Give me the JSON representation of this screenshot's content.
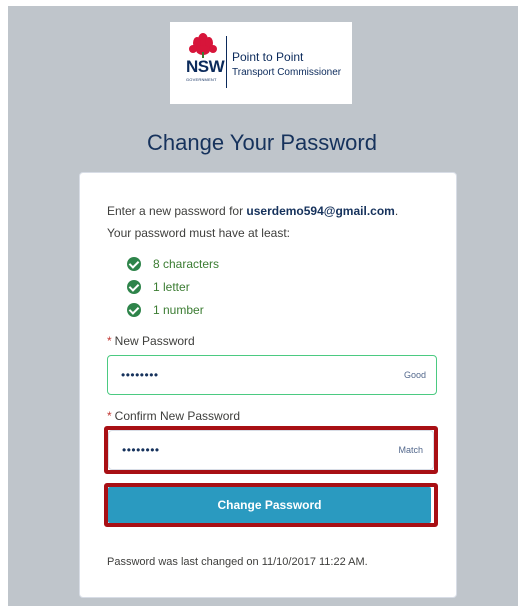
{
  "logo": {
    "nsw": "NSW",
    "government": "GOVERNMENT",
    "line1": "Point to Point",
    "line2": "Transport Commissioner"
  },
  "title": "Change Your Password",
  "form": {
    "intro_prefix": "Enter a new password for ",
    "email": "userdemo594@gmail.com",
    "intro_suffix": ".",
    "requirements_intro": "Your password must have at least:",
    "requirements": [
      "8 characters",
      "1 letter",
      "1 number"
    ],
    "required_marker": "*",
    "new_password_label": "New Password",
    "new_password_value": "••••••••",
    "new_password_strength": "Good",
    "confirm_password_label": "Confirm New Password",
    "confirm_password_value": "••••••••",
    "confirm_password_status": "Match",
    "submit_label": "Change Password",
    "last_changed": "Password was last changed on 11/10/2017 11:22 AM."
  },
  "colors": {
    "background": "#bfc5cb",
    "accent_button": "#2a9ac0",
    "highlight": "#a80f14",
    "success": "#2e844a",
    "title": "#16325c"
  }
}
